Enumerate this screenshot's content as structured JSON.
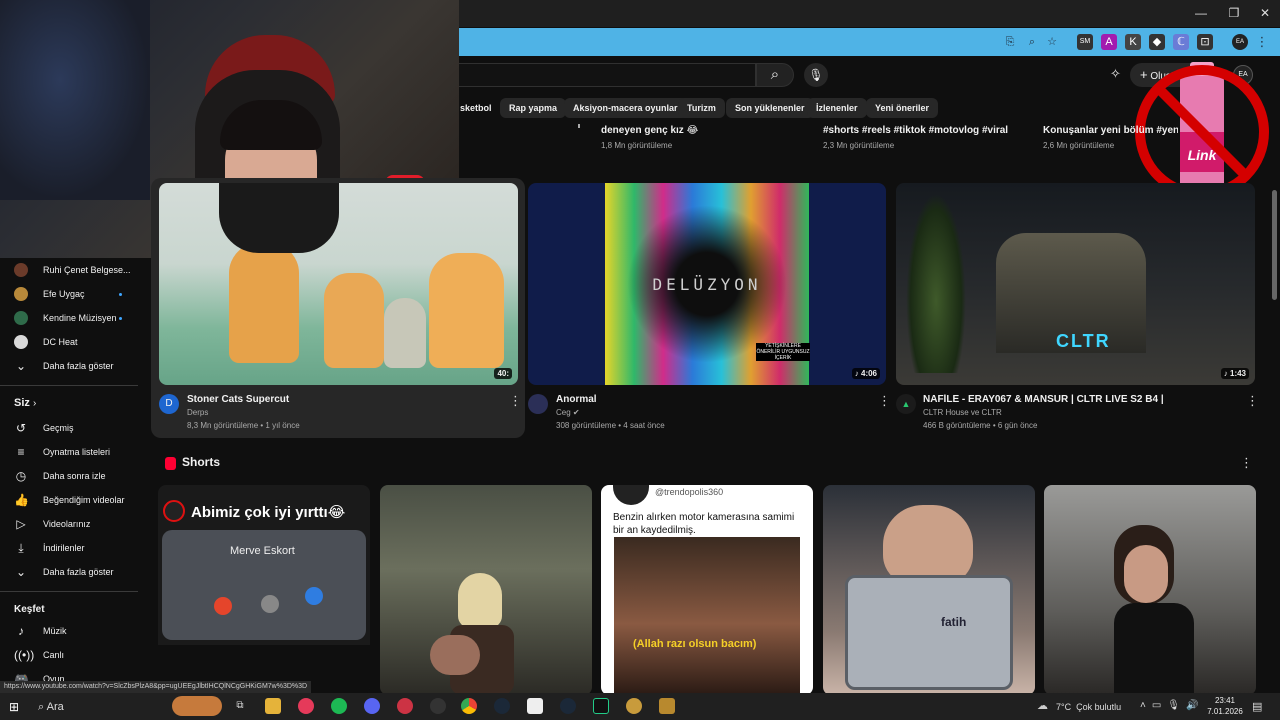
{
  "colors": {
    "accent": "#3ea6ff",
    "shorts_red": "#ff0033",
    "url_bar": "#4fb3e6"
  },
  "browser": {
    "window_controls": [
      "—",
      "❐",
      "✕"
    ],
    "extension_labels": [
      "SM",
      "A",
      "K",
      "◆",
      "ℂ",
      "⊡"
    ]
  },
  "header": {
    "create_label": "Oluştur",
    "create_icon": "plus-icon",
    "avatar_initials": "EA"
  },
  "chips": [
    "sketbol",
    "Rap yapma",
    "Aksiyon-macera oyunları",
    "Turizm",
    "Son yüklenenler",
    "İzlenenler",
    "Yeni öneriler"
  ],
  "top_row": [
    {
      "title": "deneyen genç kız 😂",
      "meta": "1,8 Mn görüntüleme"
    },
    {
      "title": "#shorts #reels #tiktok #motovlog #viral ...",
      "meta": "2,3 Mn görüntüleme"
    },
    {
      "title": "Konuşanlar yeni bölüm #yenibölü",
      "meta": "2,6 Mn görüntüleme"
    }
  ],
  "sidebar": {
    "subs": [
      {
        "label": "Ruhi Çenet Belgese...",
        "dot": false
      },
      {
        "label": "Efe Uygaç",
        "dot": true
      },
      {
        "label": "Kendine Müzisyen",
        "dot": true
      },
      {
        "label": "DC Heat",
        "dot": false
      }
    ],
    "show_more": "Daha fazla göster",
    "you_header": "Siz",
    "you_items": [
      "Geçmiş",
      "Oynatma listeleri",
      "Daha sonra izle",
      "Beğendiğim videolar",
      "Videolarınız",
      "İndirilenler",
      "Daha fazla göster"
    ],
    "explore_header": "Keşfet",
    "explore_items": [
      "Müzik",
      "Canlı",
      "Oyun"
    ]
  },
  "videos": [
    {
      "title": "Stoner Cats Supercut",
      "channel": "Derps",
      "meta": "8,3 Mn görüntüleme • 1 yıl önce",
      "duration": "40:",
      "channel_initial": "D"
    },
    {
      "title": "Anormal",
      "channel": "Ceg",
      "meta": "308 görüntüleme • 4 saat önce",
      "duration": "♪ 4:06",
      "thumb_text": "DELÜZYON",
      "thumb_label": "YETİŞKİNLERE ÖNERİLİR UYGUNSUZ İÇERİK"
    },
    {
      "title": "NAFİLE - ERAY067 & MANSUR | CLTR LIVE S2 B4 |",
      "channel": "CLTR House ve CLTR",
      "meta": "466 B görüntüleme • 6 gün önce",
      "duration": "♪ 1:43",
      "thumb_text": "CLTR"
    }
  ],
  "shorts": {
    "title": "Shorts",
    "items": [
      {
        "caption": "Abimiz çok iyi yırttı😂",
        "caller": "Merve Eskort"
      },
      {},
      {
        "handle": "@trendopolis360",
        "caption": "Benzin alırken motor kamerasına samimi bir an kaydedilmiş.",
        "subtitle": "(Allah razı olsun bacım)"
      },
      {
        "tablet_text": "fatih"
      },
      {}
    ]
  },
  "status_url": "https://www.youtube.com/watch?v=SlcZbsPlzA8&pp=ugUEEgJlbtIHCQlNCgGHKiGM7w%3D%3D",
  "taskbar": {
    "search": "Ara",
    "weather": "7°C  Çok bulutlu",
    "time": "23:41",
    "date": "7.01.2026"
  }
}
